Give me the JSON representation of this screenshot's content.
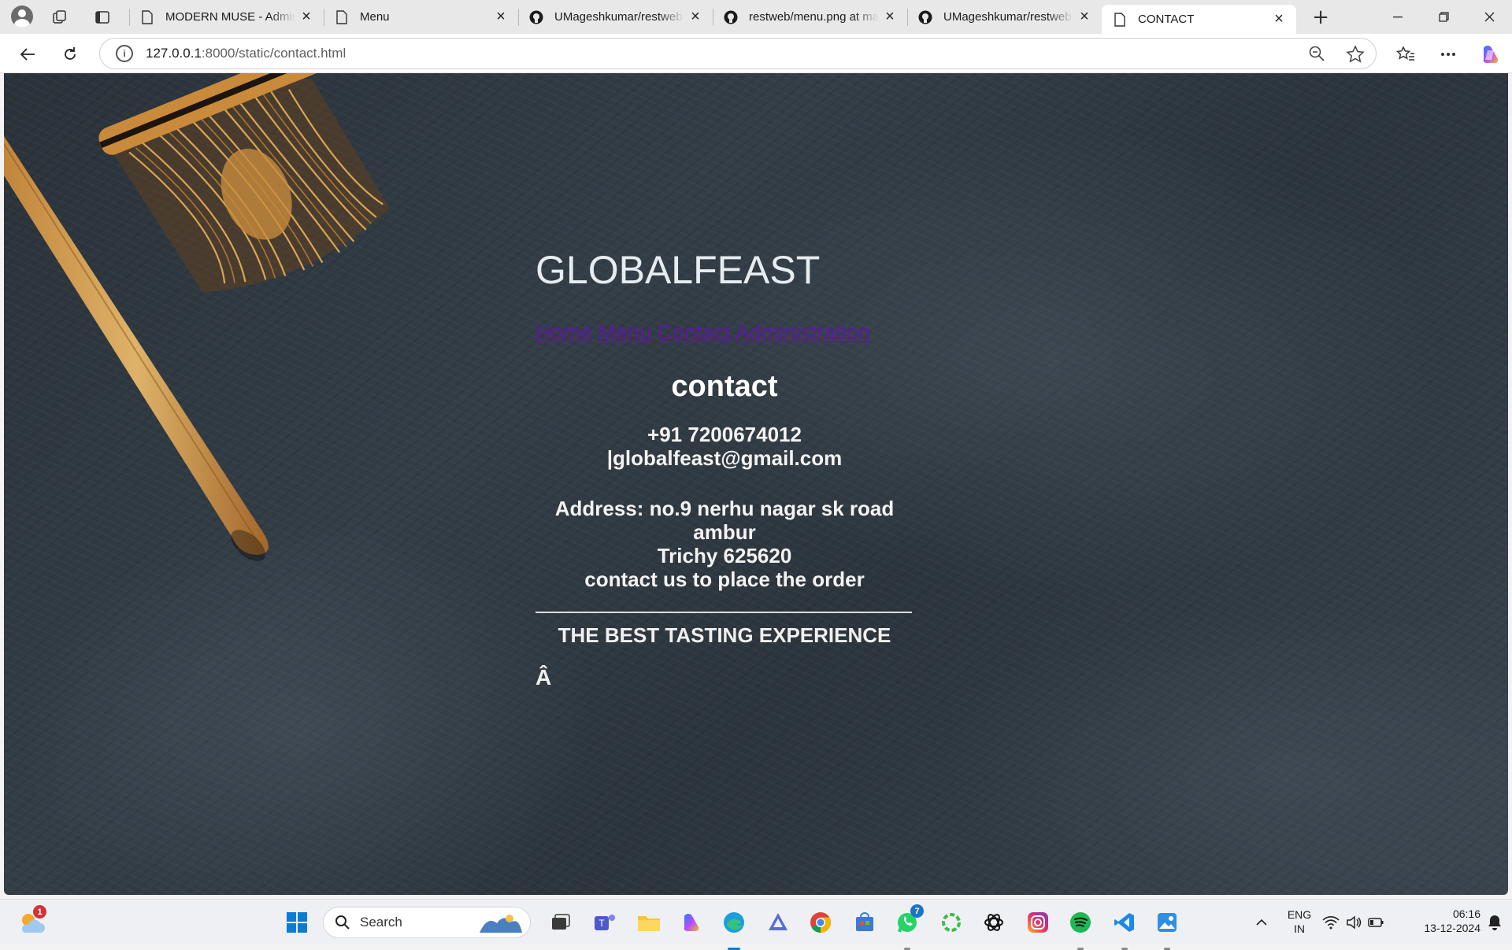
{
  "browser": {
    "tabs": [
      {
        "title": "MODERN MUSE - Admini",
        "icon": "document-icon",
        "active": false
      },
      {
        "title": "Menu",
        "icon": "document-icon",
        "active": false
      },
      {
        "title": "UMageshkumar/restweb",
        "icon": "github-icon",
        "active": false
      },
      {
        "title": "restweb/menu.png at mai",
        "icon": "github-icon",
        "active": false
      },
      {
        "title": "UMageshkumar/restweb",
        "icon": "github-icon",
        "active": false
      },
      {
        "title": "CONTACT",
        "icon": "document-icon",
        "active": true
      }
    ],
    "address": {
      "host": "127.0.0.1",
      "rest": ":8000/static/contact.html"
    }
  },
  "page": {
    "brand": "GLOBALFEAST",
    "nav": [
      "Home",
      "Menu",
      "Contact",
      "Administration"
    ],
    "heading": "contact",
    "phone": "+91 7200674012",
    "email": "|globalfeast@gmail.com",
    "address_line1": "Address: no.9 nerhu nagar sk road ambur",
    "address_line2": "Trichy 625620",
    "cta": "contact us to place the order",
    "tagline": "THE BEST TASTING EXPERIENCE",
    "stray_char": "Â"
  },
  "taskbar": {
    "search_placeholder": "Search",
    "weather_badge": "1",
    "whatsapp_badge": "7",
    "lang_line1": "ENG",
    "lang_line2": "IN",
    "time": "06:16",
    "date": "13-12-2024"
  },
  "colors": {
    "link": "#5a1b9e",
    "page_bg": "#2f3840",
    "tabstrip": "#e8e8e8"
  }
}
